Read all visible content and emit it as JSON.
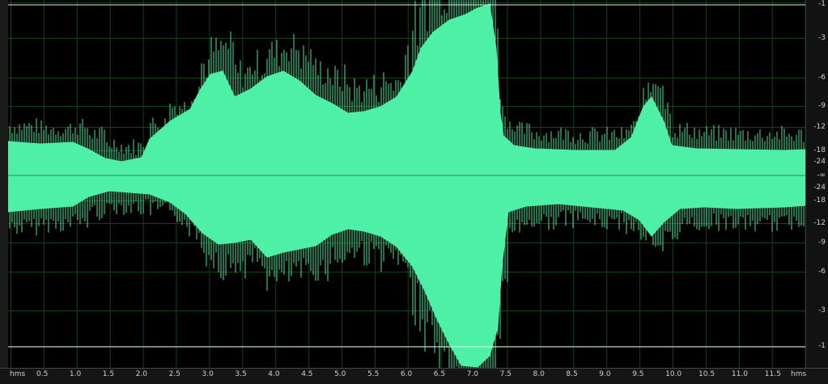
{
  "colors": {
    "background": "#000000",
    "waveform": "#4EEFA6",
    "grid": "#114411",
    "center_line": "#2f8a4a",
    "clip_line": "#e8e8e8",
    "ruler_text": "#cfcfcf"
  },
  "time_ruler": {
    "unit_left": "hms",
    "unit_right": "hms",
    "ticks": [
      "0.5",
      "1.0",
      "1.5",
      "2.0",
      "2.5",
      "3.0",
      "3.5",
      "4.0",
      "4.5",
      "5.0",
      "5.5",
      "6.0",
      "6.5",
      "7.0",
      "7.5",
      "8.0",
      "8.5",
      "9.0",
      "9.5",
      "10.0",
      "10.5",
      "11.0",
      "11.5"
    ]
  },
  "db_ruler": {
    "labels": [
      "-1",
      "-3",
      "-6",
      "-9",
      "-12",
      "-18",
      "-24",
      "-∞",
      "-24",
      "-18",
      "-12",
      "-9",
      "-6",
      "-3",
      "-1"
    ]
  }
}
